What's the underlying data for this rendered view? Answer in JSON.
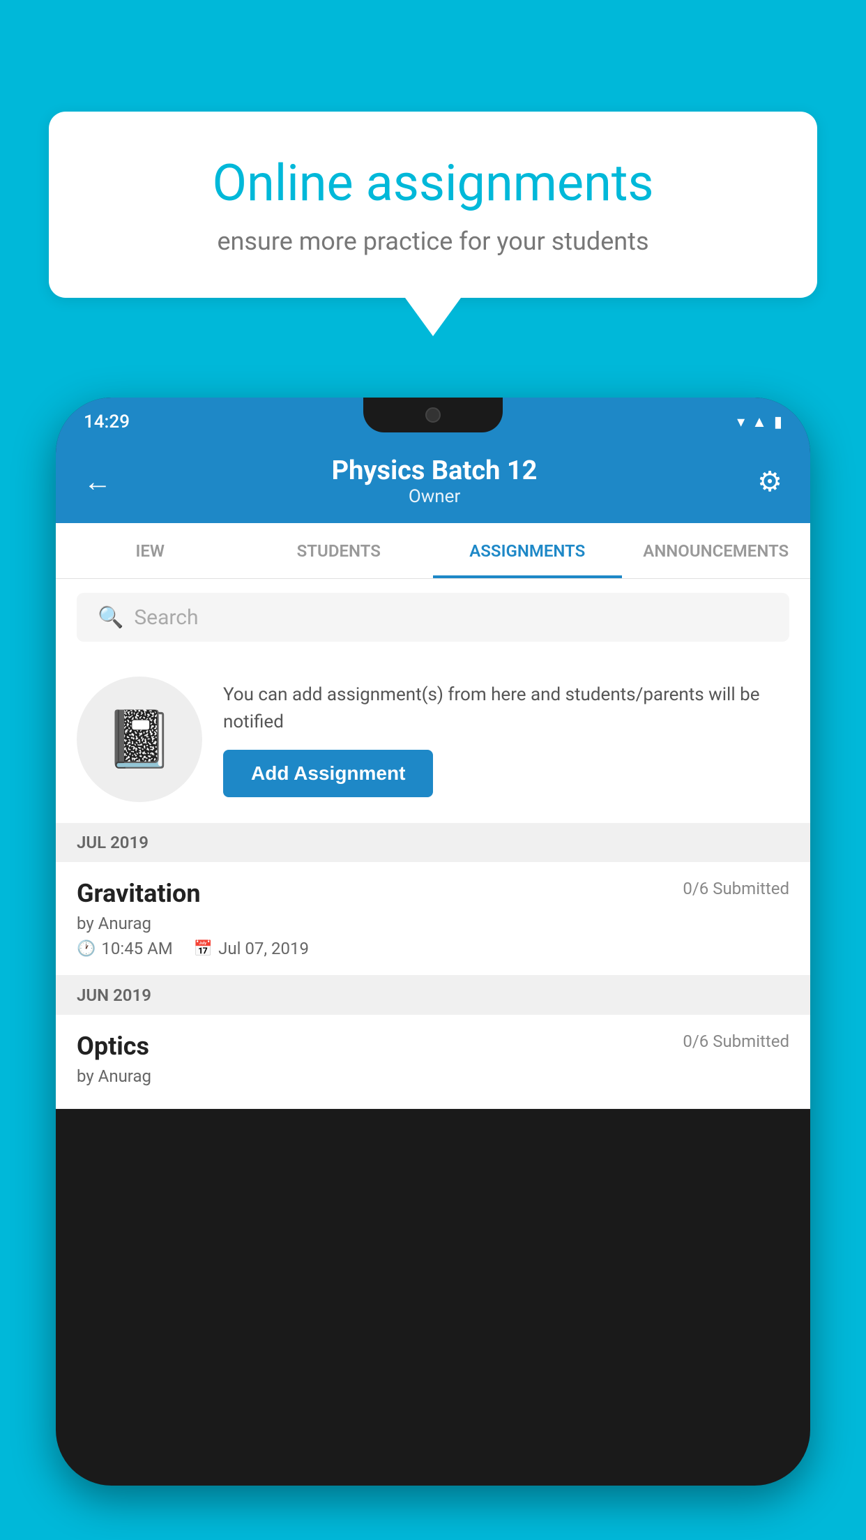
{
  "background_color": "#00B8D9",
  "speech_bubble": {
    "title": "Online assignments",
    "subtitle": "ensure more practice for your students"
  },
  "phone": {
    "status_bar": {
      "time": "14:29",
      "icons": [
        "wifi",
        "signal",
        "battery"
      ]
    },
    "header": {
      "title": "Physics Batch 12",
      "subtitle": "Owner",
      "back_label": "←",
      "settings_label": "⚙"
    },
    "tabs": [
      {
        "label": "IEW",
        "active": false
      },
      {
        "label": "STUDENTS",
        "active": false
      },
      {
        "label": "ASSIGNMENTS",
        "active": true
      },
      {
        "label": "ANNOUNCEMENTS",
        "active": false
      }
    ],
    "search": {
      "placeholder": "Search"
    },
    "add_assignment_section": {
      "description": "You can add assignment(s) from here and students/parents will be notified",
      "button_label": "Add Assignment"
    },
    "sections": [
      {
        "label": "JUL 2019",
        "assignments": [
          {
            "name": "Gravitation",
            "submitted": "0/6 Submitted",
            "by": "by Anurag",
            "time": "10:45 AM",
            "date": "Jul 07, 2019"
          }
        ]
      },
      {
        "label": "JUN 2019",
        "assignments": [
          {
            "name": "Optics",
            "submitted": "0/6 Submitted",
            "by": "by Anurag",
            "time": "",
            "date": ""
          }
        ]
      }
    ]
  }
}
